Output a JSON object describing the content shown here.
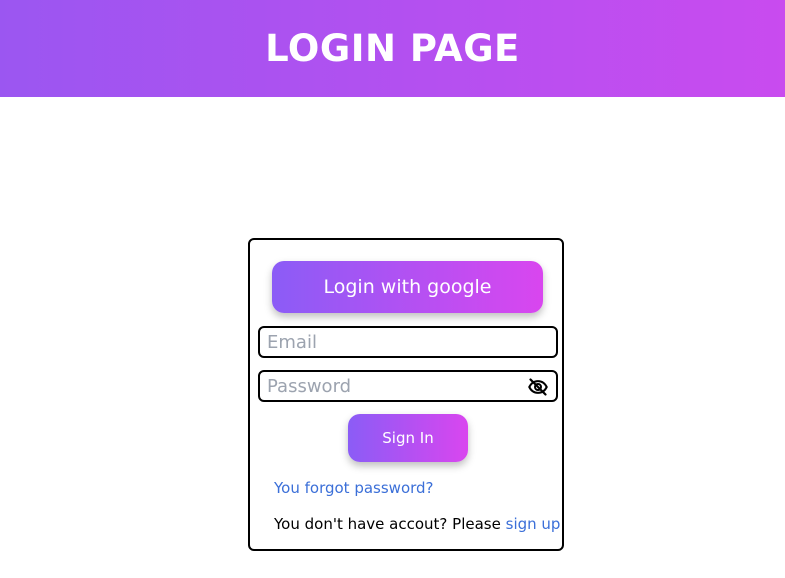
{
  "header": {
    "title": "LOGIN PAGE"
  },
  "login_card": {
    "google_button_label": "Login with google",
    "email_placeholder": "Email",
    "password_placeholder": "Password",
    "password_toggle_icon": "eye-slash-icon",
    "sign_in_label": "Sign In",
    "forgot_password_link": "You forgot password?",
    "signup_prompt": "You don't have accout? Please",
    "signup_link": "sign up"
  },
  "colors": {
    "gradient_start": "#8b5cf6",
    "gradient_end": "#d946ef",
    "link": "#3b6fd8"
  }
}
